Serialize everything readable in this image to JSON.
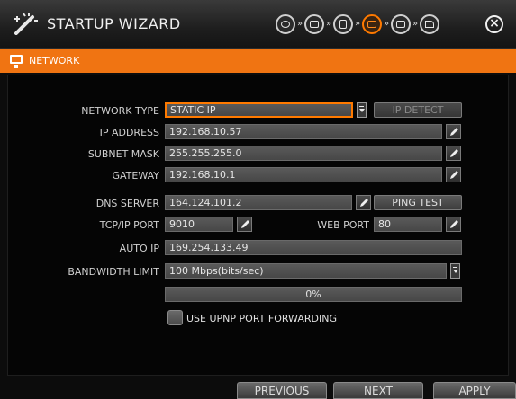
{
  "window": {
    "title": "STARTUP WIZARD",
    "steps": [
      {
        "icon": "globe-icon",
        "active": false
      },
      {
        "icon": "calendar-icon",
        "active": false
      },
      {
        "icon": "disk-icon",
        "active": false
      },
      {
        "icon": "network-monitor-icon",
        "active": true
      },
      {
        "icon": "display-icon",
        "active": false
      },
      {
        "icon": "flag-icon",
        "active": false
      }
    ],
    "close_icon": "close-icon"
  },
  "section": {
    "title": "NETWORK",
    "icon": "monitor-icon"
  },
  "form": {
    "network_type": {
      "label": "NETWORK TYPE",
      "value": "STATIC IP"
    },
    "ip_detect": {
      "label": "IP DETECT",
      "enabled": false
    },
    "ip_address": {
      "label": "IP ADDRESS",
      "value": "192.168.10.57"
    },
    "subnet_mask": {
      "label": "SUBNET MASK",
      "value": "255.255.255.0"
    },
    "gateway": {
      "label": "GATEWAY",
      "value": "192.168.10.1"
    },
    "dns_server": {
      "label": "DNS SERVER",
      "value": "164.124.101.2"
    },
    "ping_test": {
      "label": "PING TEST"
    },
    "tcp_ip_port": {
      "label": "TCP/IP PORT",
      "value": "9010"
    },
    "web_port": {
      "label": "WEB PORT",
      "value": "80"
    },
    "auto_ip": {
      "label": "AUTO IP",
      "value": "169.254.133.49"
    },
    "bandwidth_limit": {
      "label": "BANDWIDTH LIMIT",
      "value": "100 Mbps(bits/sec)"
    },
    "progress": {
      "text": "0%",
      "value": 0
    },
    "upnp": {
      "label": "USE UPNP PORT FORWARDING",
      "checked": false
    }
  },
  "footer": {
    "previous": "PREVIOUS",
    "next": "NEXT",
    "apply": "APPLY"
  },
  "colors": {
    "accent": "#f07412",
    "field": "#505050",
    "background": "#050505"
  }
}
